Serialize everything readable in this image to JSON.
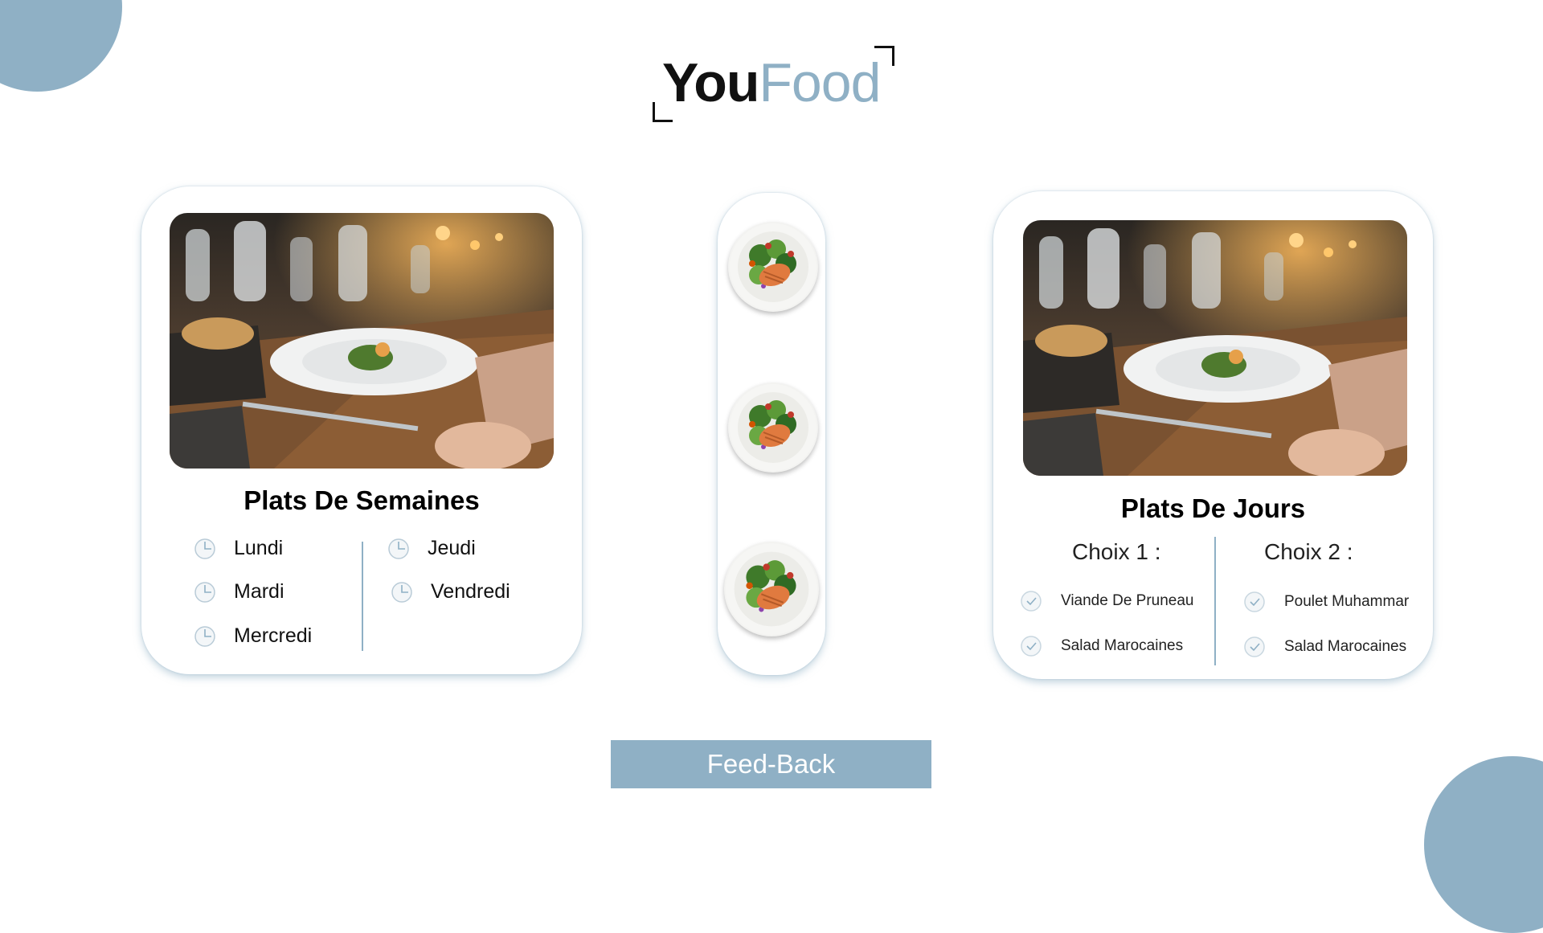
{
  "brand": {
    "part1": "You",
    "part2": "Food"
  },
  "weekly": {
    "title": "Plats De Semaines",
    "days_left": [
      "Lundi",
      "Mardi",
      "Mercredi"
    ],
    "days_right": [
      "Jeudi",
      "Vendredi"
    ]
  },
  "daily": {
    "title": "Plats De Jours",
    "choice1": {
      "label": "Choix 1 :",
      "items": [
        "Viande De Pruneau",
        "Salad Marocaines"
      ]
    },
    "choice2": {
      "label": "Choix 2 :",
      "items": [
        "Poulet Muhammar",
        "Salad Marocaines"
      ]
    }
  },
  "feedback": {
    "label": "Feed-Back"
  },
  "colors": {
    "accent": "#8fb0c5",
    "text": "#111111"
  },
  "icons": {
    "day": "clock-icon",
    "dish": "check-icon",
    "plate": "salad-plate-icon"
  }
}
